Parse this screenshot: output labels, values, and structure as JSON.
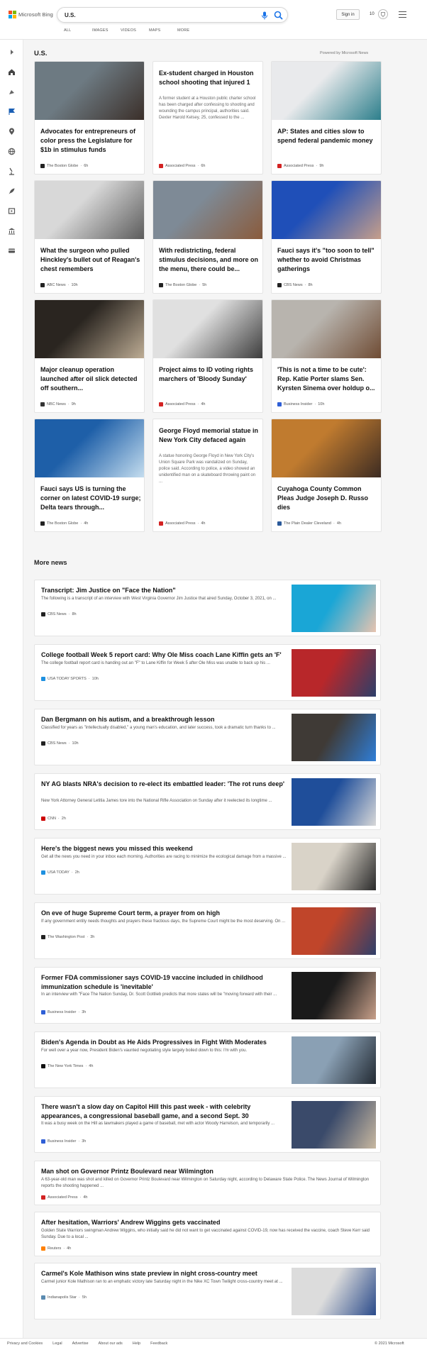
{
  "header": {
    "logo_text": "Microsoft Bing",
    "search_value": "U.S.",
    "tabs": [
      "ALL",
      "IMAGES",
      "VIDEOS",
      "MAPS",
      "MORE"
    ],
    "signin_label": "Sign in",
    "points": "10"
  },
  "rail": {
    "icons": [
      "expand-icon",
      "home-icon",
      "compass-icon",
      "flag-icon",
      "location-pin-icon",
      "globe-icon",
      "microscope-icon",
      "rocket-icon",
      "film-icon",
      "bank-icon",
      "card-icon"
    ]
  },
  "main": {
    "section_title": "U.S.",
    "powered_by": "Powered by Microsoft News",
    "more_news_title": "More news"
  },
  "cards": [
    {
      "title": "Advocates for entrepreneurs of color press the Legislature for $1b in stimulus funds",
      "source": "The Boston Globe",
      "age": "6h",
      "logo_color": "#222222",
      "img": [
        "#6d7a82",
        "#3a2e28"
      ]
    },
    {
      "title": "Ex-student charged in Houston school shooting that injured 1",
      "snippet": "A former student at a Houston public charter school has been charged after confessing to shooting and wounding the campus principal, authorities said. Dexter Harold Kelsey, 25, confessed to the ...",
      "source": "Associated Press",
      "age": "6h",
      "logo_color": "#d32323"
    },
    {
      "title": "AP: States and cities slow to spend federal pandemic money",
      "source": "Associated Press",
      "age": "9h",
      "logo_color": "#d32323",
      "img": [
        "#e9eaec",
        "#2a7d8a"
      ]
    },
    {
      "title": "What the surgeon who pulled Hinckley's bullet out of Reagan's chest remembers",
      "source": "ABC News",
      "age": "10h",
      "logo_color": "#222222",
      "img": [
        "#d8d8d8",
        "#5a5a5a"
      ]
    },
    {
      "title": "With redistricting, federal stimulus decisions, and more on the menu, there could be...",
      "source": "The Boston Globe",
      "age": "5h",
      "logo_color": "#222222",
      "img": [
        "#7e8a96",
        "#8a5a3a"
      ]
    },
    {
      "title": "Fauci says it's \"too soon to tell\" whether to avoid Christmas gatherings",
      "source": "CBS News",
      "age": "8h",
      "logo_color": "#222222",
      "img": [
        "#1f4fb8",
        "#c9a08a"
      ]
    },
    {
      "title": "Major cleanup operation launched after oil slick detected off southern...",
      "source": "NBC News",
      "age": "9h",
      "logo_color": "#333333",
      "img": [
        "#2a2520",
        "#bfae96"
      ]
    },
    {
      "title": "Project aims to ID voting rights marchers of 'Bloody Sunday'",
      "source": "Associated Press",
      "age": "4h",
      "logo_color": "#d32323",
      "img": [
        "#e0e0e0",
        "#3a3a3a"
      ]
    },
    {
      "title": "'This is not a time to be cute': Rep. Katie Porter slams Sen. Kyrsten Sinema over holdup o...",
      "source": "Business Insider",
      "age": "10h",
      "logo_color": "#2f5fd6",
      "img": [
        "#b8b4ae",
        "#6e4a32"
      ]
    },
    {
      "title": "Fauci says US is turning the corner on latest COVID-19 surge; Delta tears through...",
      "source": "The Boston Globe",
      "age": "4h",
      "logo_color": "#222222",
      "img": [
        "#1e5fa8",
        "#c7dff0"
      ]
    },
    {
      "title": "George Floyd memorial statue in New York City defaced again",
      "snippet": "A statue honoring George Floyd in New York City's Union Square Park was vandalized on Sunday, police said. According to police, a video showed an unidentified man on a skateboard throwing paint on ...",
      "source": "Associated Press",
      "age": "4h",
      "logo_color": "#d32323"
    },
    {
      "title": "Cuyahoga County Common Pleas Judge Joseph D. Russo dies",
      "source": "The Plain Dealer Cleveland",
      "age": "4h",
      "logo_color": "#2b5a9a",
      "img": [
        "#c07b2f",
        "#3a2a22"
      ]
    }
  ],
  "more_news": [
    {
      "title": "Transcript: Jim Justice on \"Face the Nation\"",
      "snippet": "The following is a transcript of an interview with West Virginia Governor Jim Justice that aired Sunday, October 3, 2021, on ...",
      "source": "CBS News",
      "age": "8h",
      "logo_color": "#222222",
      "img": [
        "#1aa6d6",
        "#e8c4b0"
      ]
    },
    {
      "title": "College football Week 5 report card: Why Ole Miss coach Lane Kiffin gets an 'F'",
      "snippet": "The college football report card is handing out an \"F\" to Lane Kiffin for Week 5 after Ole Miss was unable to back up his ...",
      "source": "USA TODAY SPORTS",
      "age": "10h",
      "logo_color": "#1e90e0",
      "img": [
        "#b8272a",
        "#2c3f6a"
      ]
    },
    {
      "title": "Dan Bergmann on his autism, and a breakthrough lesson",
      "snippet": "Classified for years as \"intellectually disabled,\" a young man's education, and later success, took a dramatic turn thanks to ...",
      "source": "CBS News",
      "age": "10h",
      "logo_color": "#222222",
      "img": [
        "#3f3a36",
        "#2f7ed8"
      ]
    },
    {
      "title": "NY AG blasts NRA's decision to re-elect its embattled leader: 'The rot runs deep'",
      "snippet": "New York Attorney General Letitia James tore into the National Rifle Association on Sunday after it reelected its longtime ...",
      "source": "CNN",
      "age": "2h",
      "logo_color": "#cc0000",
      "img": [
        "#1f4e9a",
        "#d8d8d8"
      ]
    },
    {
      "title": "Here's the biggest news you missed this weekend",
      "snippet": "Get all the news you need in your inbox each morning. Authorities are racing to minimize the ecological damage from a massive ...",
      "source": "USA TODAY",
      "age": "2h",
      "logo_color": "#1e90e0",
      "img": [
        "#d9d3c8",
        "#2a2a2a"
      ]
    },
    {
      "title": "On eve of huge Supreme Court term, a prayer from on high",
      "snippet": "If any government entity needs thoughts and prayers these fractious days, the Supreme Court might be the most deserving. On ...",
      "source": "The Washington Post",
      "age": "3h",
      "logo_color": "#222222",
      "img": [
        "#c0452a",
        "#2f3f6a"
      ]
    },
    {
      "title": "Former FDA commissioner says COVID-19 vaccine included in childhood immunization schedule is 'inevitable'",
      "snippet": "In an interview with \"Face The Nation Sunday, Dr. Scott Gottlieb predicts that more states will be \"moving forward with their ...",
      "source": "Business Insider",
      "age": "3h",
      "logo_color": "#2f5fd6",
      "img": [
        "#1a1a1a",
        "#c8a08a"
      ]
    },
    {
      "title": "Biden's Agenda in Doubt as He Aids Progressives in Fight With Moderates",
      "snippet": "For well over a year now, President Biden's vaunted negotiating style largely boiled down to this: I'm with you.",
      "source": "The New York Times",
      "age": "4h",
      "logo_color": "#111111",
      "img": [
        "#8aa0b4",
        "#222a33"
      ]
    },
    {
      "title": "There wasn't a slow day on Capitol Hill this past week - with celebrity appearances, a congressional baseball game, and a second Sept. 30",
      "snippet": "It was a busy week on the Hill as lawmakers played a game of baseball, met with actor Woody Harrelson, and temporarily ...",
      "source": "Business Insider",
      "age": "3h",
      "logo_color": "#2f5fd6",
      "img": [
        "#3a4a6a",
        "#c8b8a0"
      ]
    },
    {
      "title": "Man shot on Governor Printz Boulevard near Wilmington",
      "snippet": "A 63-year-old man was shot and killed on Governor Printz Boulevard near Wilmington on Saturday night, according to Delaware State Police. The News Journal of Wilmington reports the shooting happened ...",
      "source": "Associated Press",
      "age": "4h",
      "logo_color": "#d32323"
    },
    {
      "title": "After hesitation, Warriors' Andrew Wiggins gets vaccinated",
      "snippet": "Golden State Warriors swingman Andrew Wiggins, who initially said he did not want to get vaccinated against COVID-19, now has received the vaccine, coach Steve Kerr said Sunday. Due to a local ...",
      "source": "Reuters",
      "age": "4h",
      "logo_color": "#ff8000"
    },
    {
      "title": "Carmel's Kole Mathison wins state preview in night cross-country meet",
      "snippet": "Carmel junior Kole Mathison ran to an emphatic victory late Saturday night in the Nike XC Town Twilight cross-country meet at ...",
      "source": "Indianapolis Star",
      "age": "5h",
      "logo_color": "#5a8ab0",
      "img": [
        "#dcdcdc",
        "#2a4a8a"
      ]
    }
  ],
  "footer": {
    "links": [
      "Privacy and Cookies",
      "Legal",
      "Advertise",
      "About our ads",
      "Help",
      "Feedback"
    ],
    "copyright": "© 2021 Microsoft"
  }
}
